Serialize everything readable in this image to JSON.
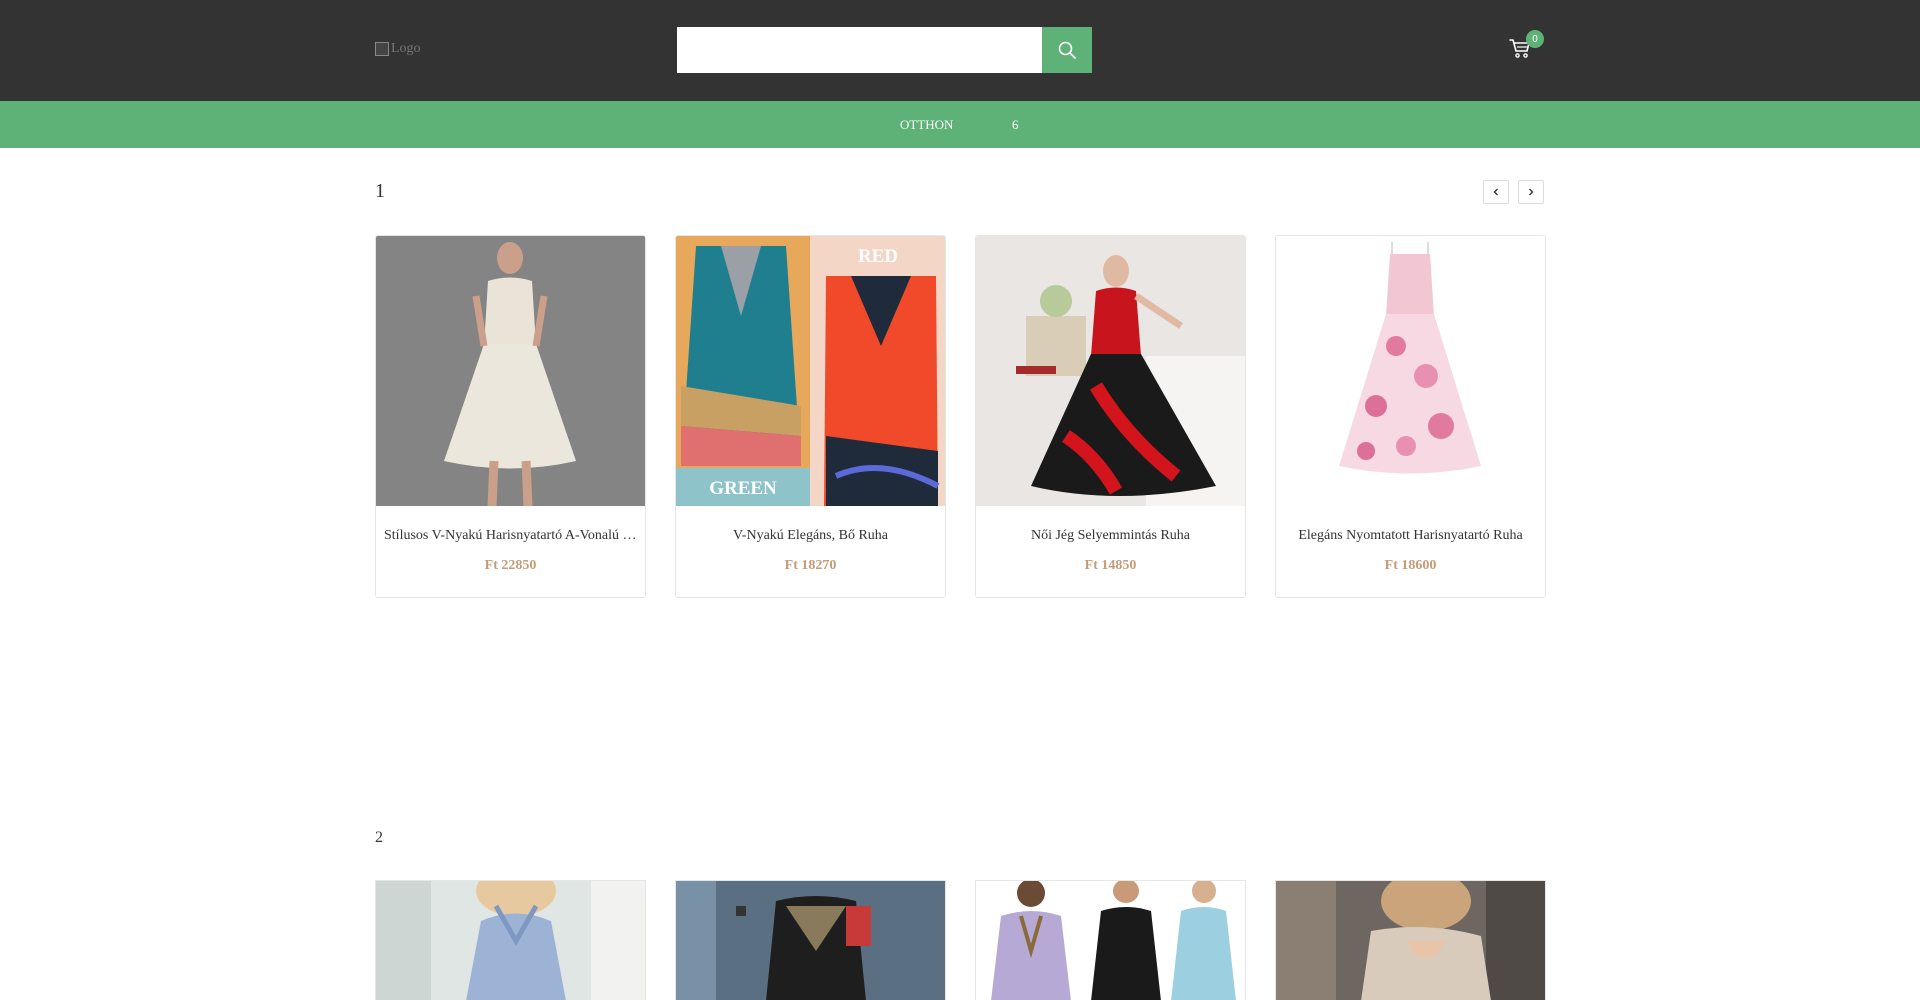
{
  "header": {
    "logo_alt": "Logo",
    "search": {
      "value": "",
      "placeholder": ""
    },
    "cart_count": "0"
  },
  "nav": {
    "items": [
      {
        "label": "OTTHON"
      },
      {
        "label": "6"
      }
    ]
  },
  "sections": [
    {
      "title": "1",
      "products": [
        {
          "name": "Stílusos V-Nyakú Harisnyatartó A-Vonalú Ruha",
          "price": "Ft 22850"
        },
        {
          "name": "V-Nyakú Elegáns, Bő Ruha",
          "price": "Ft 18270",
          "image_labels": {
            "top": "RED",
            "bottom": "GREEN"
          }
        },
        {
          "name": "Női Jég Selyemmintás Ruha",
          "price": "Ft 14850"
        },
        {
          "name": "Elegáns Nyomtatott Harisnyatartó Ruha",
          "price": "Ft 18600"
        }
      ]
    },
    {
      "title": "2"
    }
  ],
  "colors": {
    "header_bg": "#333333",
    "accent": "#5fb277",
    "price": "#c59b75"
  },
  "icons": [
    "search-icon",
    "cart-icon",
    "chevron-left-icon",
    "chevron-right-icon"
  ]
}
